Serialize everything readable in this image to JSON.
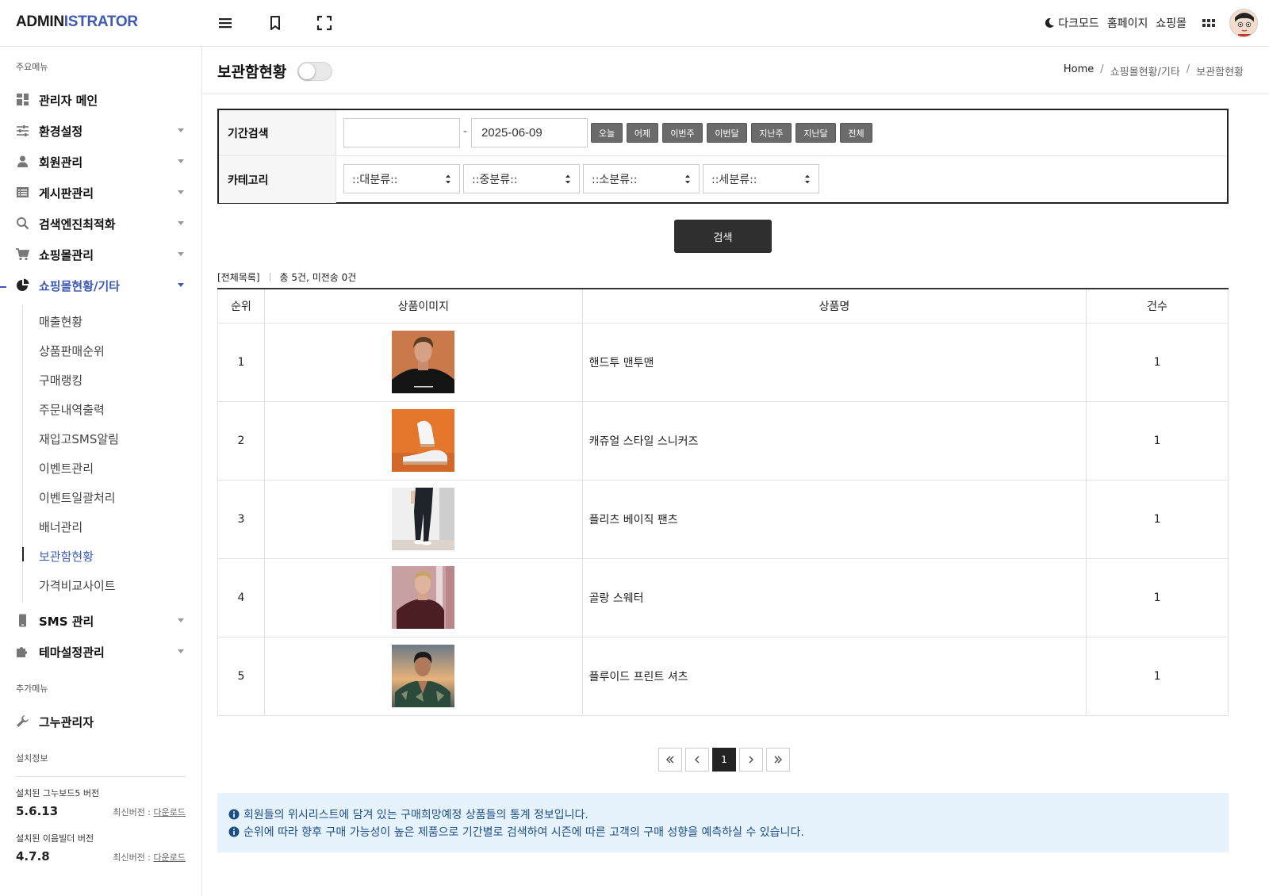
{
  "header": {
    "logo_part1": "ADMIN",
    "logo_part2": "ISTRATOR",
    "dark_mode": "다크모드",
    "homepage": "홈페이지",
    "shop": "쇼핑몰"
  },
  "sidebar": {
    "main_menu_label": "주요메뉴",
    "items": [
      {
        "label": "관리자 메인",
        "icon": "dashboard-icon"
      },
      {
        "label": "환경설정",
        "icon": "sliders-icon"
      },
      {
        "label": "회원관리",
        "icon": "user-icon"
      },
      {
        "label": "게시판관리",
        "icon": "list-icon"
      },
      {
        "label": "검색엔진최적화",
        "icon": "search-icon"
      },
      {
        "label": "쇼핑몰관리",
        "icon": "cart-icon"
      },
      {
        "label": "쇼핑몰현황/기타",
        "icon": "pie-chart-icon"
      }
    ],
    "subitems": [
      "매출현황",
      "상품판매순위",
      "구매랭킹",
      "주문내역출력",
      "재입고SMS알림",
      "이벤트관리",
      "이벤트일괄처리",
      "배너관리",
      "보관함현황",
      "가격비교사이트"
    ],
    "items2": [
      {
        "label": "SMS 관리",
        "icon": "phone-icon"
      },
      {
        "label": "테마설정관리",
        "icon": "puzzle-icon"
      }
    ],
    "extra_menu_label": "추가메뉴",
    "extra_item": {
      "label": "그누관리자",
      "icon": "wrench-icon"
    },
    "install_label": "설치정보",
    "install": [
      {
        "label": "설치된 그누보드5 버전",
        "version": "5.6.13",
        "latest": "최신버전 : ",
        "download": "다운로드"
      },
      {
        "label": "설치된 이음빌더 버전",
        "version": "4.7.8",
        "latest": "최신버전 : ",
        "download": "다운로드"
      }
    ]
  },
  "page": {
    "title": "보관함현황",
    "breadcrumb": [
      "Home",
      "쇼핑몰현황/기타",
      "보관함현황"
    ]
  },
  "search": {
    "period_label": "기간검색",
    "date_from": "",
    "date_to": "2025-06-09",
    "quick_buttons": [
      "오늘",
      "어제",
      "이번주",
      "이번달",
      "지난주",
      "지난달",
      "전체"
    ],
    "category_label": "카테고리",
    "selects": [
      "::대분류::",
      "::중분류::",
      "::소분류::",
      "::세분류::"
    ],
    "submit": "검색"
  },
  "list": {
    "title": "[전체목록]",
    "summary": "총 5건, 미전송 0건",
    "headers": [
      "순위",
      "상품이미지",
      "상품명",
      "건수"
    ],
    "rows": [
      {
        "rank": "1",
        "name": "핸드투 맨투맨",
        "count": "1"
      },
      {
        "rank": "2",
        "name": "캐쥬얼 스타일 스니커즈",
        "count": "1"
      },
      {
        "rank": "3",
        "name": "플리츠 베이직 팬츠",
        "count": "1"
      },
      {
        "rank": "4",
        "name": "골랑 스웨터",
        "count": "1"
      },
      {
        "rank": "5",
        "name": "플루이드 프린트 셔츠",
        "count": "1"
      }
    ]
  },
  "pagination": {
    "current": "1"
  },
  "info": [
    "회원들의 위시리스트에 담겨 있는 구매희망예정 상품들의 통계 정보입니다.",
    "순위에 따라 향후 구매 가능성이 높은 제품으로 기간별로 검색하여 시즌에 따른 고객의 구매 성향을 예측하실 수 있습니다."
  ],
  "colors": {
    "accent": "#3f5bb0",
    "info_bg": "#e7f3fc",
    "info_text": "#1b4d86"
  }
}
